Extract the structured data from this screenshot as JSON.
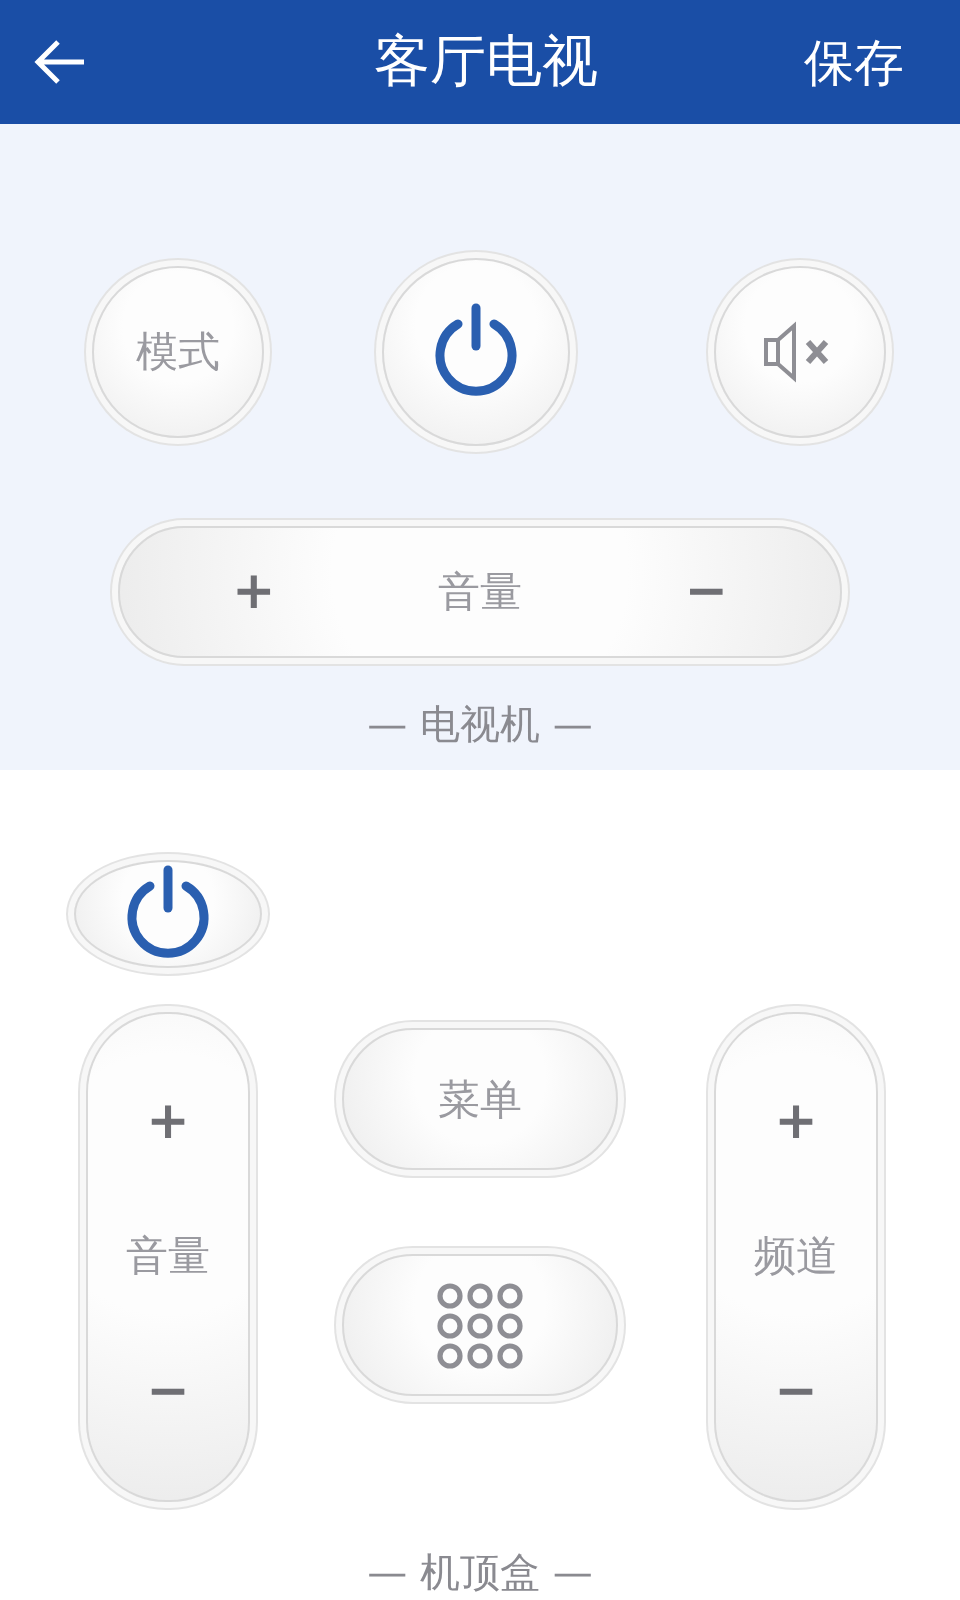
{
  "header": {
    "title": "客厅电视",
    "action": "保存"
  },
  "tv": {
    "mode_button": "模式",
    "volume": {
      "plus": "+",
      "label": "音量",
      "minus": "−"
    },
    "section_label": "— 电视机 —"
  },
  "set_top_box": {
    "volume": {
      "plus": "+",
      "label": "音量",
      "minus": "−"
    },
    "menu_button": "菜单",
    "channel": {
      "plus": "+",
      "label": "频道",
      "minus": "−"
    },
    "section_label": "— 机顶盒 —"
  }
}
